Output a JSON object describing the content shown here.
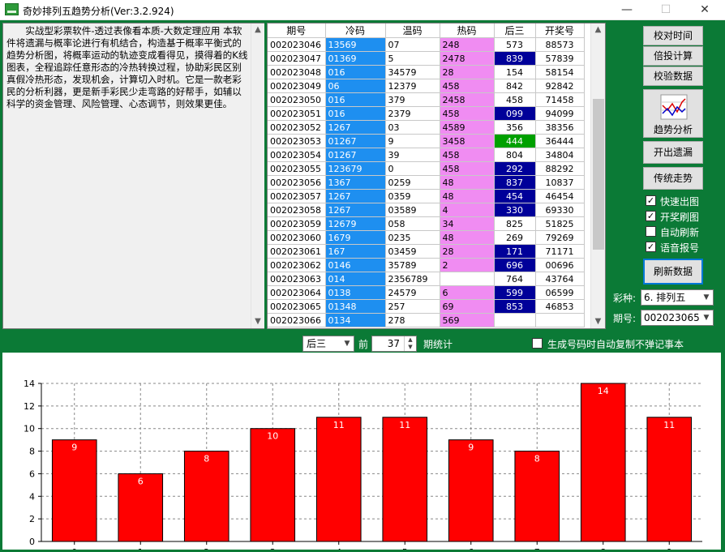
{
  "window": {
    "title": "奇妙排列五趋势分析(Ver:3.2.924)",
    "min_glyph": "—",
    "max_glyph": "☐",
    "close_glyph": "✕"
  },
  "description": "实战型彩票软件-透过表像看本质-大数定理应用 本软件将遗漏与概率论进行有机结合，构造基于概率平衡式的趋势分析图，将概率运动的轨迹变成看得见，摸得着的K线图表，全程追踪任意形态的冷热转换过程，协助彩民区别真假冷热形态，发现机会，计算切入时机。它是一款老彩民的分析利器，更是新手彩民少走弯路的好帮手，如辅以科学的资金管理、风险管理、心态调节，则效果更佳。",
  "table": {
    "headers": [
      "期号",
      "冷码",
      "温码",
      "热码",
      "后三",
      "开奖号"
    ],
    "rows": [
      {
        "period": "002023046",
        "cold": "13569",
        "warm": "07",
        "hot": "248",
        "back": "573",
        "back_style": "plain",
        "win": "88573"
      },
      {
        "period": "002023047",
        "cold": "01369",
        "warm": "5",
        "hot": "2478",
        "back": "839",
        "back_style": "blue",
        "win": "57839"
      },
      {
        "period": "002023048",
        "cold": "016",
        "warm": "34579",
        "hot": "28",
        "back": "154",
        "back_style": "plain",
        "win": "58154"
      },
      {
        "period": "002023049",
        "cold": "06",
        "warm": "12379",
        "hot": "458",
        "back": "842",
        "back_style": "plain",
        "win": "92842"
      },
      {
        "period": "002023050",
        "cold": "016",
        "warm": "379",
        "hot": "2458",
        "back": "458",
        "back_style": "plain",
        "win": "71458"
      },
      {
        "period": "002023051",
        "cold": "016",
        "warm": "2379",
        "hot": "458",
        "back": "099",
        "back_style": "blue",
        "win": "94099"
      },
      {
        "period": "002023052",
        "cold": "1267",
        "warm": "03",
        "hot": "4589",
        "back": "356",
        "back_style": "plain",
        "win": "38356"
      },
      {
        "period": "002023053",
        "cold": "01267",
        "warm": "9",
        "hot": "3458",
        "back": "444",
        "back_style": "green",
        "win": "36444"
      },
      {
        "period": "002023054",
        "cold": "01267",
        "warm": "39",
        "hot": "458",
        "back": "804",
        "back_style": "plain",
        "win": "34804"
      },
      {
        "period": "002023055",
        "cold": "123679",
        "warm": "0",
        "hot": "458",
        "back": "292",
        "back_style": "blue",
        "win": "88292"
      },
      {
        "period": "002023056",
        "cold": "1367",
        "warm": "0259",
        "hot": "48",
        "back": "837",
        "back_style": "blue",
        "win": "10837"
      },
      {
        "period": "002023057",
        "cold": "1267",
        "warm": "0359",
        "hot": "48",
        "back": "454",
        "back_style": "blue",
        "win": "46454"
      },
      {
        "period": "002023058",
        "cold": "1267",
        "warm": "03589",
        "hot": "4",
        "back": "330",
        "back_style": "blue",
        "win": "69330"
      },
      {
        "period": "002023059",
        "cold": "12679",
        "warm": "058",
        "hot": "34",
        "back": "825",
        "back_style": "plain",
        "win": "51825"
      },
      {
        "period": "002023060",
        "cold": "1679",
        "warm": "0235",
        "hot": "48",
        "back": "269",
        "back_style": "plain",
        "win": "79269"
      },
      {
        "period": "002023061",
        "cold": "167",
        "warm": "03459",
        "hot": "28",
        "back": "171",
        "back_style": "blue",
        "win": "71171"
      },
      {
        "period": "002023062",
        "cold": "0146",
        "warm": "35789",
        "hot": "2",
        "back": "696",
        "back_style": "blue",
        "win": "00696"
      },
      {
        "period": "002023063",
        "cold": "014",
        "warm": "2356789",
        "hot": "",
        "back": "764",
        "back_style": "plain",
        "win": "43764"
      },
      {
        "period": "002023064",
        "cold": "0138",
        "warm": "24579",
        "hot": "6",
        "back": "599",
        "back_style": "blue",
        "win": "06599"
      },
      {
        "period": "002023065",
        "cold": "01348",
        "warm": "257",
        "hot": "69",
        "back": "853",
        "back_style": "blue",
        "win": "46853"
      },
      {
        "period": "002023066",
        "cold": "0134",
        "warm": "278",
        "hot": "569",
        "back": "",
        "back_style": "plain",
        "win": ""
      }
    ]
  },
  "buttons": {
    "check_time": "校对时间",
    "multi_bet": "倍投计算",
    "verify_data": "校验数据",
    "trend_analysis": "趋势分析",
    "missing_out": "开出遗漏",
    "traditional_trend": "传统走势",
    "refresh": "刷新数据"
  },
  "checkboxes": [
    {
      "label": "快速出图",
      "checked": true
    },
    {
      "label": "开奖刷图",
      "checked": true
    },
    {
      "label": "自动刷新",
      "checked": false
    },
    {
      "label": "语音报号",
      "checked": true
    }
  ],
  "lottery": {
    "label": "彩种:",
    "value": "6. 排列五"
  },
  "issue": {
    "label": "期号:",
    "value": "002023065"
  },
  "toolbar": {
    "position_value": "后三",
    "label_a": "前",
    "period_count": "37",
    "label_b": "期统计",
    "autocopy_label": "生成号码时自动复制不弹记事本",
    "autocopy_checked": false
  },
  "chart_data": {
    "type": "bar",
    "categories": [
      "0",
      "1",
      "2",
      "3",
      "4",
      "5",
      "6",
      "7",
      "8",
      "9"
    ],
    "values": [
      9,
      6,
      8,
      10,
      11,
      11,
      9,
      8,
      14,
      11
    ],
    "ylim": [
      0,
      14
    ],
    "yticks": [
      0,
      2,
      4,
      6,
      8,
      10,
      12,
      14
    ],
    "bar_color": "#ff0000",
    "grid": true
  }
}
